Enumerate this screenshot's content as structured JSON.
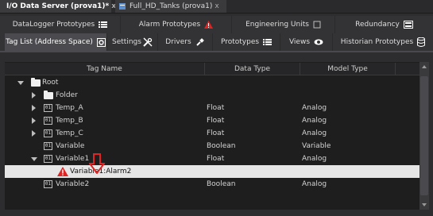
{
  "doc_tabs": [
    {
      "label": "I/O Data Server (prova1)*",
      "close": "x"
    },
    {
      "label": "Full_HD_Tanks (prova1)",
      "close": "x"
    }
  ],
  "tabs_row1": [
    {
      "label": "DataLogger Prototypes",
      "icon": "list-icon"
    },
    {
      "label": "Alarm Prototypes",
      "icon": "warning-icon"
    },
    {
      "label": "Engineering Units",
      "icon": "units-icon"
    },
    {
      "label": "Redundancy",
      "icon": "redundancy-icon"
    }
  ],
  "tabs_row2": [
    {
      "label": "Tag List (Address Space)",
      "icon": "gear-icon",
      "selected": true
    },
    {
      "label": "Settings",
      "icon": "wrench-icon"
    },
    {
      "label": "Drivers",
      "icon": "plug-icon"
    },
    {
      "label": "Prototypes",
      "icon": "list-icon"
    },
    {
      "label": "Views",
      "icon": "eye-icon"
    },
    {
      "label": "Historian Prototypes",
      "icon": "database-icon"
    }
  ],
  "table": {
    "columns": [
      "Tag Name",
      "Data Type",
      "Model Type"
    ],
    "rows": [
      {
        "name": "Root",
        "type": "",
        "model": ""
      },
      {
        "name": "Folder",
        "type": "",
        "model": ""
      },
      {
        "name": "Temp_A",
        "type": "Float",
        "model": "Analog"
      },
      {
        "name": "Temp_B",
        "type": "Float",
        "model": "Analog"
      },
      {
        "name": "Temp_C",
        "type": "Float",
        "model": "Analog"
      },
      {
        "name": "Variable",
        "type": "Boolean",
        "model": "Variable"
      },
      {
        "name": "Variable1",
        "type": "Float",
        "model": "Analog"
      },
      {
        "name": "Variable1:Alarm2",
        "type": "",
        "model": ""
      },
      {
        "name": "Variable2",
        "type": "Boolean",
        "model": "Analog"
      }
    ]
  },
  "colors": {
    "accent_warning": "#e02424",
    "highlight_arrow": "#e02424",
    "selection": "#e6e6e6"
  }
}
